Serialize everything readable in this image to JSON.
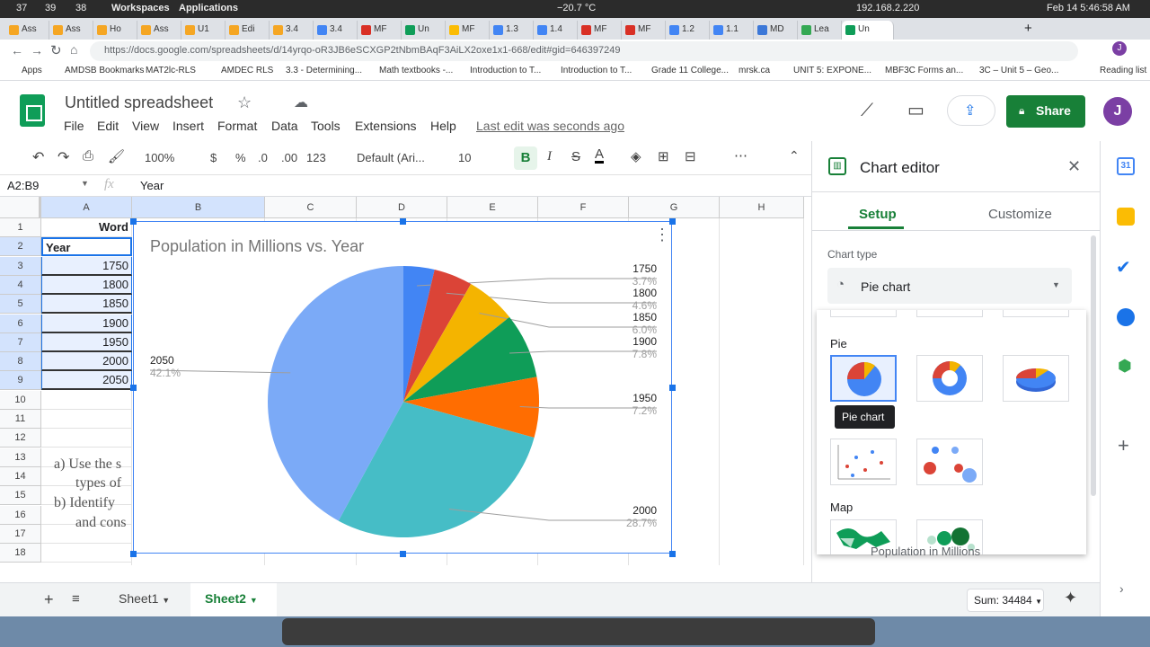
{
  "os_bar": {
    "stats": [
      "37",
      "39",
      "38"
    ],
    "workspaces": "Workspaces",
    "applications": "Applications",
    "temperature": "−20.7 °C",
    "ip": "192.168.2.220",
    "datetime": "Feb 14  5:46:58 AM"
  },
  "browser": {
    "tabs": [
      {
        "label": "Ass",
        "color": "#f5a623"
      },
      {
        "label": "Ass",
        "color": "#f5a623"
      },
      {
        "label": "Ho",
        "color": "#f5a623"
      },
      {
        "label": "Ass",
        "color": "#f5a623"
      },
      {
        "label": "U1",
        "color": "#f5a623"
      },
      {
        "label": "Edi",
        "color": "#f5a623"
      },
      {
        "label": "3.4",
        "color": "#f5a623"
      },
      {
        "label": "3.4",
        "color": "#4285f4"
      },
      {
        "label": "MF",
        "color": "#d93025"
      },
      {
        "label": "Un",
        "color": "#0f9d58"
      },
      {
        "label": "MF",
        "color": "#fbbc04"
      },
      {
        "label": "1.3",
        "color": "#4285f4"
      },
      {
        "label": "1.4",
        "color": "#4285f4"
      },
      {
        "label": "MF",
        "color": "#d93025"
      },
      {
        "label": "MF",
        "color": "#d93025"
      },
      {
        "label": "1.2",
        "color": "#4285f4"
      },
      {
        "label": "1.1",
        "color": "#4285f4"
      },
      {
        "label": "MD",
        "color": "#3c78d8"
      },
      {
        "label": "Lea",
        "color": "#34a853"
      },
      {
        "label": "Un",
        "color": "#0f9d58"
      }
    ],
    "url": "https://docs.google.com/spreadsheets/d/14yrqo-oR3JB6eSCXGP2tNbmBAqF3AiLX2oxe1x1-668/edit#gid=646397249",
    "bookmarks": [
      "Apps",
      "AMDSB Bookmarks",
      "MAT2lc-RLS",
      "AMDEC RLS",
      "3.3 - Determining...",
      "Math textbooks -...",
      "Introduction to T...",
      "Introduction to T...",
      "Grade 11 College...",
      "mrsk.ca",
      "UNIT 5: EXPONE...",
      "MBF3C Forms an...",
      "3C – Unit 5 – Geo..."
    ],
    "reading_list": "Reading list"
  },
  "doc": {
    "title": "Untitled spreadsheet",
    "menus": [
      "File",
      "Edit",
      "View",
      "Insert",
      "Format",
      "Data",
      "Tools",
      "Extensions",
      "Help"
    ],
    "last_edit": "Last edit was seconds ago",
    "share": "Share",
    "avatar_initial": "J"
  },
  "toolbar": {
    "zoom": "100%",
    "currency": "$",
    "percent": "%",
    "dec_less": ".0",
    "dec_more": ".00",
    "number_format": "123",
    "font": "Default (Ari...",
    "font_size": "10",
    "bold": "B",
    "italic": "I",
    "strike": "S",
    "text_color": "A"
  },
  "formula_bar": {
    "name_box": "A2:B9",
    "fx": "fx",
    "value": "Year"
  },
  "grid": {
    "columns": [
      "A",
      "B",
      "C",
      "D",
      "E",
      "F",
      "G",
      "H"
    ],
    "rows": [
      "1",
      "2",
      "3",
      "4",
      "5",
      "6",
      "7",
      "8",
      "9",
      "10",
      "11",
      "12",
      "13",
      "14",
      "15",
      "16",
      "17",
      "18"
    ],
    "a1": "Word",
    "a2": "Year",
    "years": [
      "1750",
      "1800",
      "1850",
      "1900",
      "1950",
      "2000",
      "2050"
    ],
    "background_text": [
      "a)  Use the s",
      "types of",
      "b)  Identify",
      "and cons"
    ]
  },
  "chart_data": {
    "type": "pie",
    "title": "Population in Millions vs. Year",
    "categories": [
      "1750",
      "1800",
      "1850",
      "1900",
      "1950",
      "2000",
      "2050"
    ],
    "values": [
      3.7,
      4.6,
      6.0,
      7.8,
      7.2,
      28.7,
      42.1
    ],
    "labels": [
      "3.7%",
      "4.6%",
      "6.0%",
      "7.8%",
      "7.2%",
      "28.7%",
      "42.1%"
    ],
    "colors": [
      "#4285f4",
      "#db4437",
      "#f4b400",
      "#0f9d58",
      "#ff6d01",
      "#46bdc6",
      "#7baaf7"
    ],
    "legend": "labeled slices"
  },
  "editor": {
    "title": "Chart editor",
    "tabs": [
      "Setup",
      "Customize"
    ],
    "chart_type_label": "Chart type",
    "chart_type_value": "Pie chart",
    "section_pie": "Pie",
    "section_map": "Map",
    "tooltip": "Pie chart",
    "series_peek": "Population in Millions"
  },
  "sheets": {
    "tabs": [
      "Sheet1",
      "Sheet2"
    ],
    "sum": "Sum: 34484"
  }
}
